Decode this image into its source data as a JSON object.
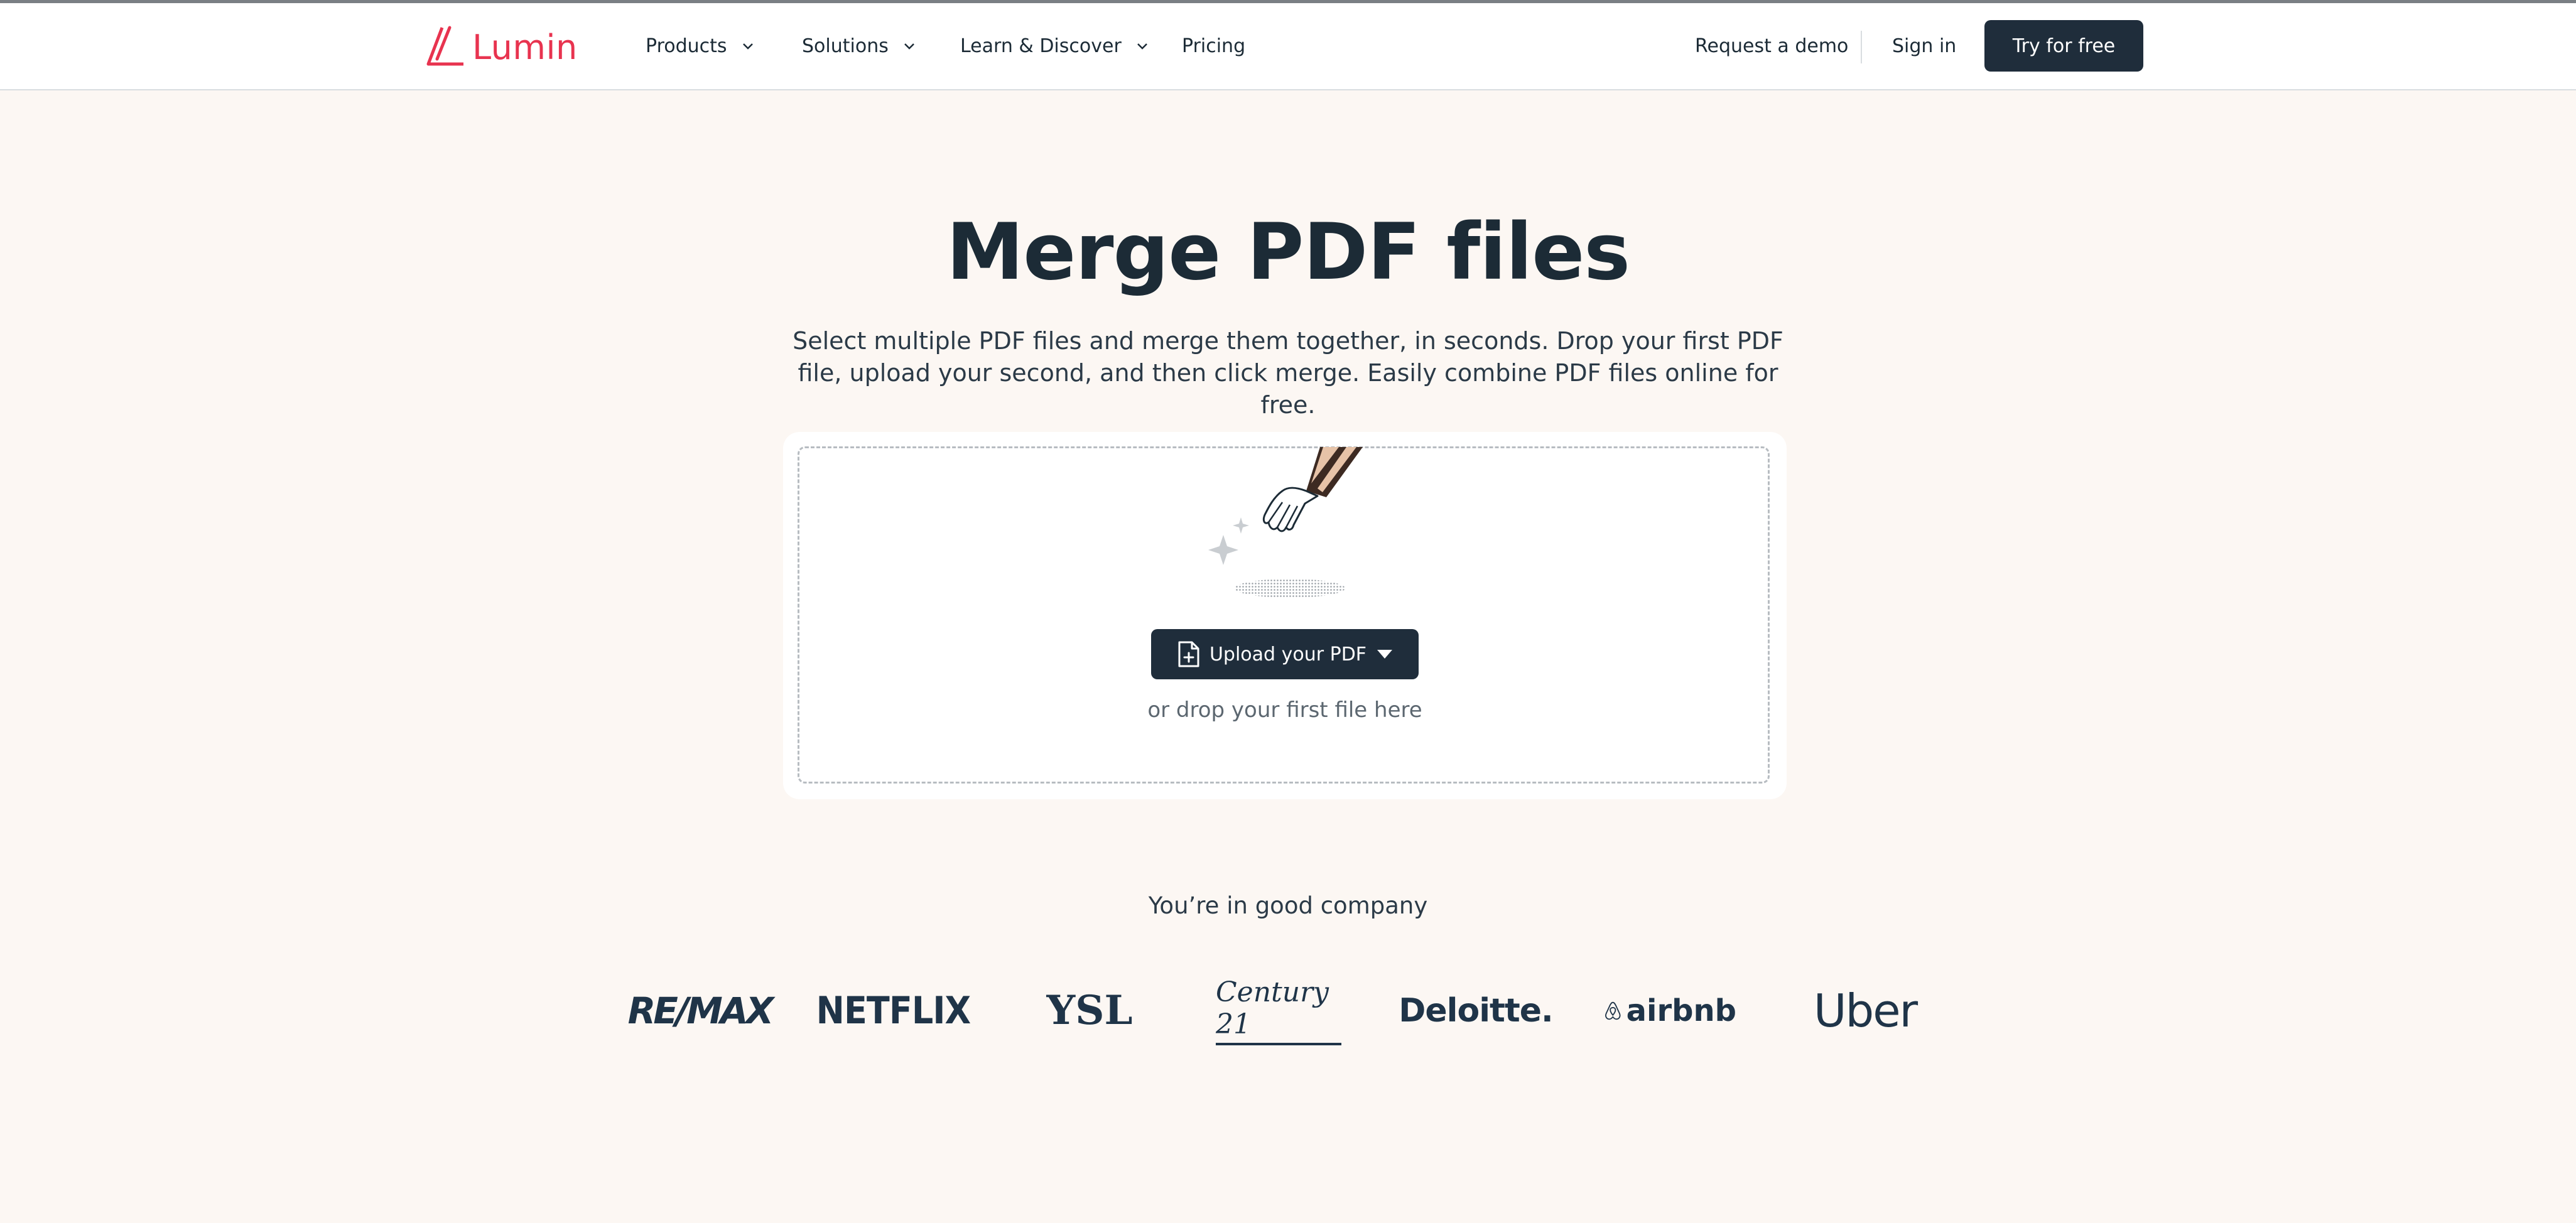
{
  "nav": {
    "logo_text": "Lumin",
    "items": [
      {
        "label": "Products",
        "has_dropdown": true
      },
      {
        "label": "Solutions",
        "has_dropdown": true
      },
      {
        "label": "Learn & Discover",
        "has_dropdown": true
      },
      {
        "label": "Pricing",
        "has_dropdown": false
      }
    ],
    "request_demo": "Request a demo",
    "sign_in": "Sign in",
    "cta": "Try for free"
  },
  "hero": {
    "title": "Merge PDF files",
    "description": "Select multiple PDF files and merge them together, in seconds. Drop your first PDF file, upload your second, and then click merge. Easily combine PDF files online for free."
  },
  "upload": {
    "button_label": "Upload your PDF",
    "hint": "or drop your first file here"
  },
  "company": {
    "title": "You’re in good company",
    "logos": [
      "RE/MAX",
      "NETFLIX",
      "YSL",
      "Century 21",
      "Deloitte.",
      "airbnb",
      "Uber"
    ]
  },
  "colors": {
    "brand": "#e8334f",
    "dark": "#1f2d3b",
    "background": "#fcf7f3"
  }
}
